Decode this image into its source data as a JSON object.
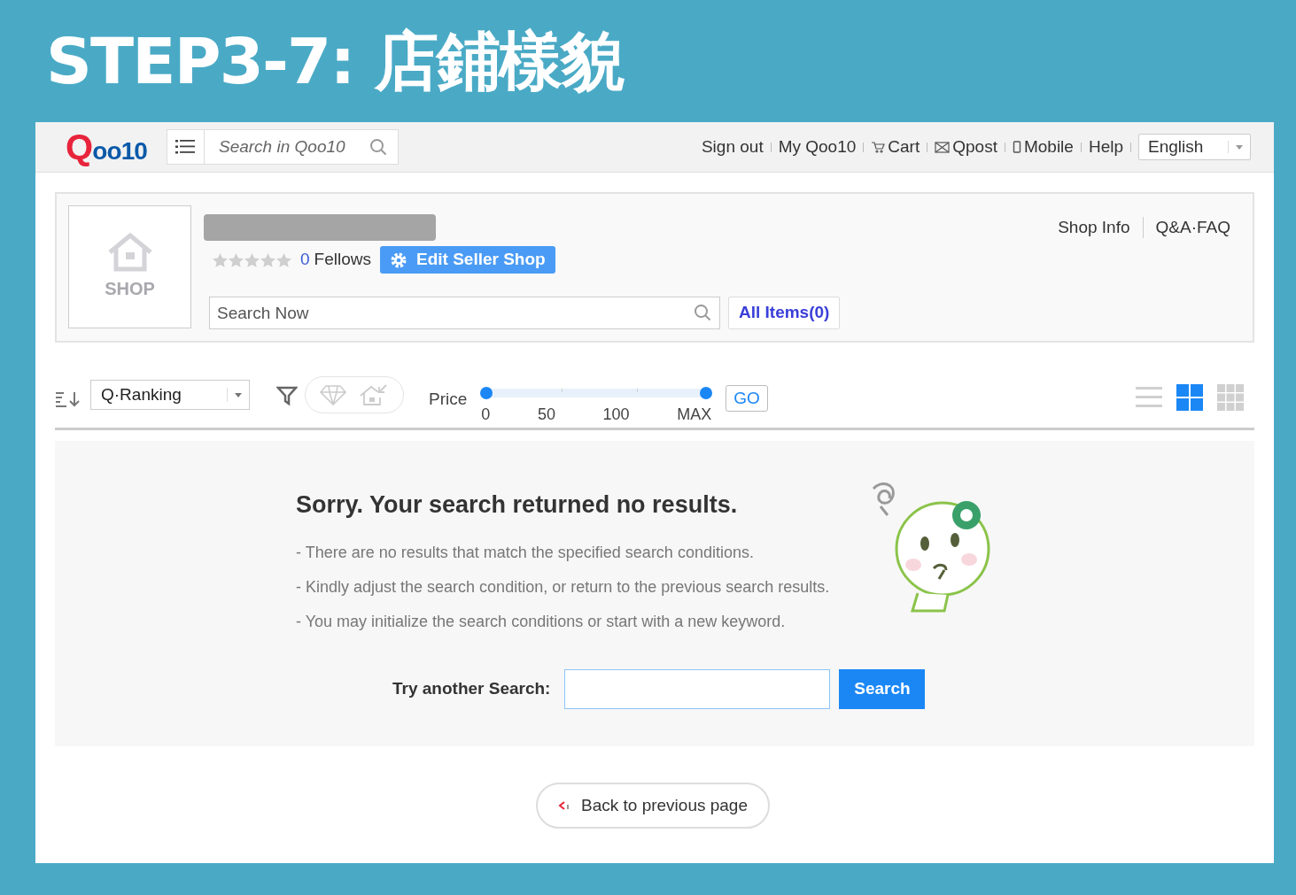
{
  "banner": {
    "title": "STEP3-7: 店鋪樣貌"
  },
  "header": {
    "logo": {
      "mark": "Q",
      "rest": "oo10"
    },
    "search": {
      "placeholder": "Search in Qoo10"
    },
    "links": [
      {
        "kind": "text",
        "label": "Sign out"
      },
      {
        "kind": "text",
        "label": "My Qoo10"
      },
      {
        "kind": "cart",
        "label": "Cart"
      },
      {
        "kind": "mail",
        "label": "Qpost"
      },
      {
        "kind": "mobile",
        "label": "Mobile"
      },
      {
        "kind": "text",
        "label": "Help"
      }
    ],
    "language": "English"
  },
  "shop": {
    "logo_text": "SHOP",
    "stars": 0,
    "fellows_count": "0",
    "fellows_label": "Fellows",
    "edit_button": "Edit Seller Shop",
    "search": {
      "placeholder": "Search Now"
    },
    "all_items": "All Items(0)",
    "links": [
      "Shop Info",
      "Q&A·FAQ"
    ]
  },
  "toolbar": {
    "sort": "Q·Ranking",
    "price_label": "Price",
    "handles": [
      {
        "level": 0
      },
      {
        "level": 1
      }
    ],
    "ticks": [
      "0",
      "50",
      "100",
      "MAX"
    ],
    "go": "GO",
    "views": [
      {
        "kind": "list",
        "selected": false
      },
      {
        "kind": "grid",
        "selected": true
      },
      {
        "kind": "small-grid",
        "selected": false
      }
    ]
  },
  "empty": {
    "title": "Sorry. Your search returned no results.",
    "lines": [
      "- There are no results that match the specified search conditions.",
      "- Kindly adjust the search condition, or return to the previous search results.",
      "- You may initialize the search conditions or start with a new keyword."
    ],
    "retry_label": "Try another Search:",
    "search_button": "Search"
  },
  "back_button": "Back to previous page"
}
